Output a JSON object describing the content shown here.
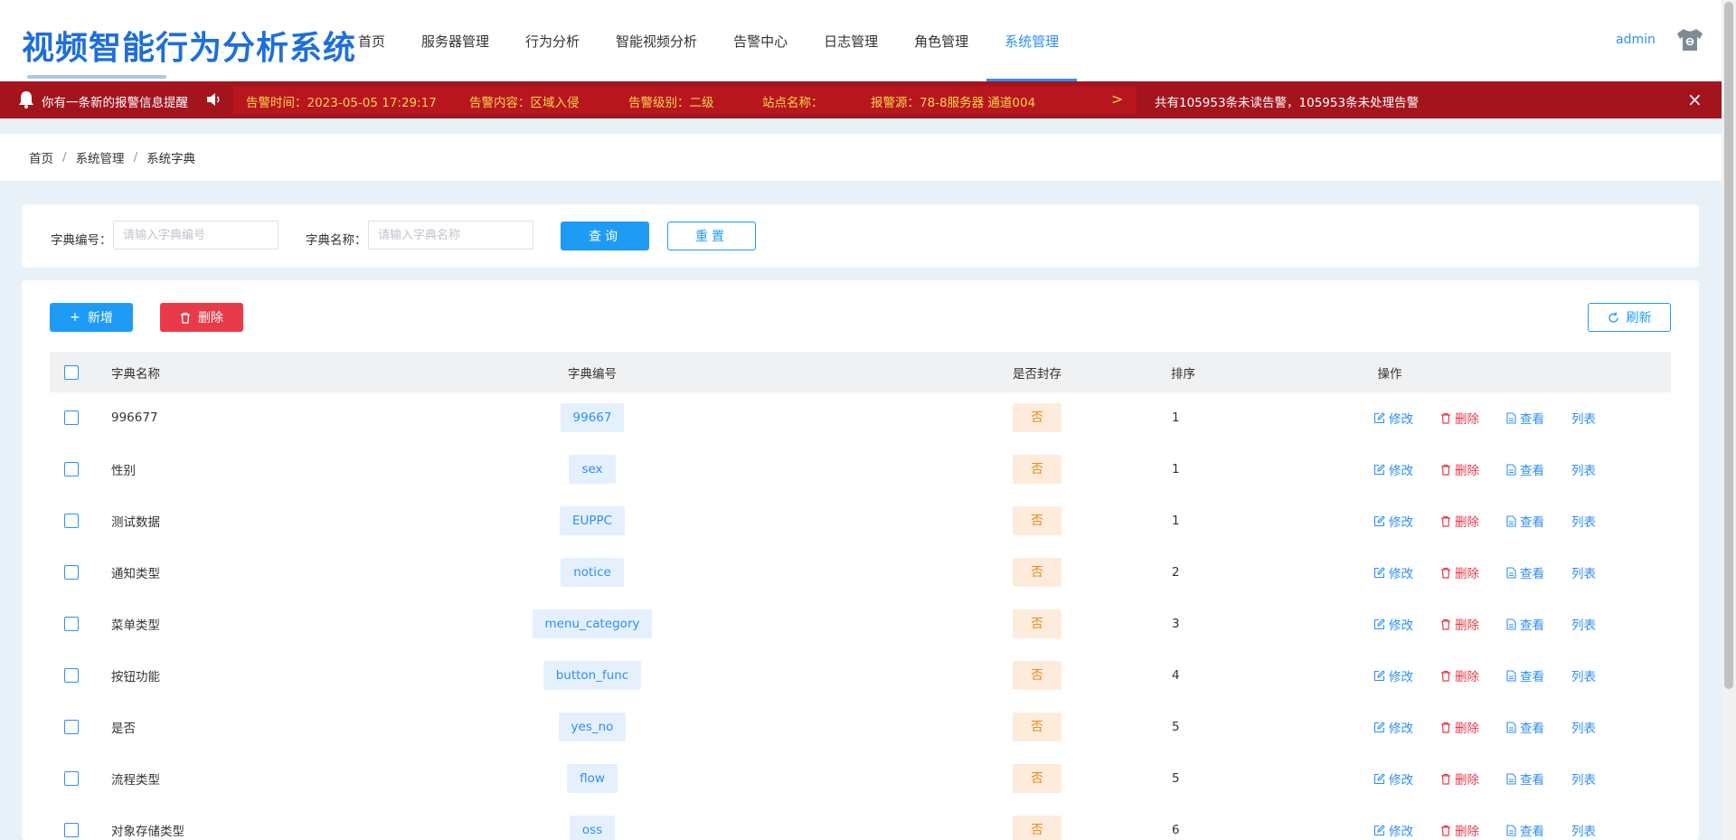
{
  "app": {
    "title": "视频智能行为分析系统",
    "user": "admin"
  },
  "nav": [
    "首页",
    "服务器管理",
    "行为分析",
    "智能视频分析",
    "告警中心",
    "日志管理",
    "角色管理",
    "系统管理"
  ],
  "alarm": {
    "notice": "你有一条新的报警信息提醒",
    "time": "告警时间：2023-05-05 17:29:17",
    "content": "告警内容：区域入侵",
    "level": "告警级别：二级",
    "site": "站点名称：",
    "source": "报警源：78-8服务器 通道004",
    "next": ">",
    "summary": "共有105953条未读告警，105953条未处理告警",
    "close": "×"
  },
  "breadcrumb": [
    "首页",
    "系统管理",
    "系统字典"
  ],
  "breadcrumb_sep": "/",
  "search": {
    "code_label": "字典编号：",
    "code_placeholder": "请输入字典编号",
    "name_label": "字典名称：",
    "name_placeholder": "请输入字典名称",
    "query": "查询",
    "reset": "重置"
  },
  "toolbar": {
    "add": "新增",
    "delete": "删除",
    "refresh": "刷新"
  },
  "table": {
    "headers": {
      "name": "字典名称",
      "code": "字典编号",
      "sealed": "是否封存",
      "sort": "排序",
      "ops": "操作"
    },
    "ops": {
      "edit": "修改",
      "delete": "删除",
      "view": "查看",
      "list": "列表"
    },
    "rows": [
      {
        "name": "996677",
        "code": "99667",
        "sealed": "否",
        "sort": "1"
      },
      {
        "name": "性别",
        "code": "sex",
        "sealed": "否",
        "sort": "1"
      },
      {
        "name": "测试数据",
        "code": "EUPPC",
        "sealed": "否",
        "sort": "1"
      },
      {
        "name": "通知类型",
        "code": "notice",
        "sealed": "否",
        "sort": "2"
      },
      {
        "name": "菜单类型",
        "code": "menu_category",
        "sealed": "否",
        "sort": "3"
      },
      {
        "name": "按钮功能",
        "code": "button_func",
        "sealed": "否",
        "sort": "4"
      },
      {
        "name": "是否",
        "code": "yes_no",
        "sealed": "否",
        "sort": "5"
      },
      {
        "name": "流程类型",
        "code": "flow",
        "sealed": "否",
        "sort": "5"
      },
      {
        "name": "对象存储类型",
        "code": "oss",
        "sealed": "否",
        "sort": "6"
      }
    ]
  },
  "colors": {
    "primary": "#2e8ff5",
    "danger": "#e83a49",
    "alarm_bg": "#a3141d",
    "alarm_text": "#f7d64a",
    "title": "#1e6fd9"
  }
}
